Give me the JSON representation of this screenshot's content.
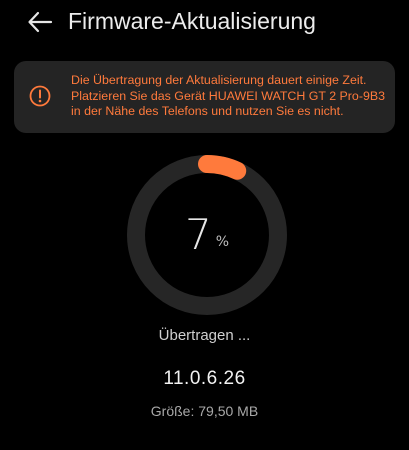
{
  "header": {
    "title": "Firmware-Aktualisierung",
    "back_icon": "arrow-left-icon"
  },
  "warning": {
    "icon": "exclamation-circle-icon",
    "lines": [
      "Die Übertragung der Aktualisierung dauert einige Zeit.",
      "Platzieren Sie das Gerät HUAWEI WATCH GT 2 Pro-9B3",
      "in der Nähe des Telefons und nutzen Sie es nicht."
    ]
  },
  "progress": {
    "value": 7,
    "value_text": "7",
    "unit": "%",
    "status": "Übertragen ..."
  },
  "firmware": {
    "version": "11.0.6.26",
    "size": "Größe: 79,50 MB"
  },
  "colors": {
    "background": "#000000",
    "accent": "#ff7a3c",
    "ring_track": "#262626",
    "card": "#242424"
  }
}
